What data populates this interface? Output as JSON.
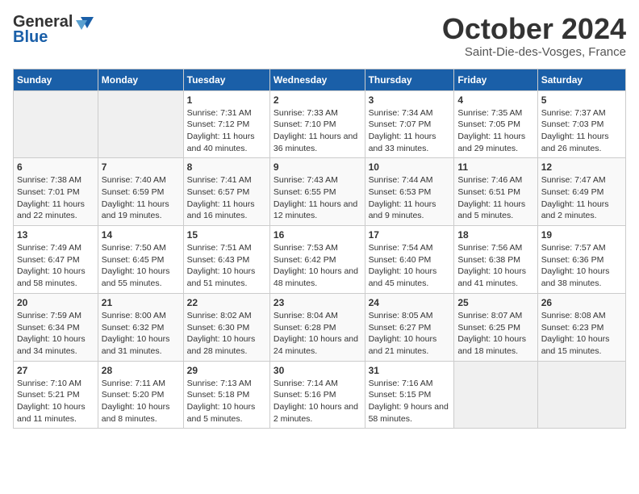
{
  "logo": {
    "general": "General",
    "blue": "Blue"
  },
  "title": "October 2024",
  "subtitle": "Saint-Die-des-Vosges, France",
  "days_header": [
    "Sunday",
    "Monday",
    "Tuesday",
    "Wednesday",
    "Thursday",
    "Friday",
    "Saturday"
  ],
  "weeks": [
    [
      {
        "day": "",
        "info": ""
      },
      {
        "day": "",
        "info": ""
      },
      {
        "day": "1",
        "info": "Sunrise: 7:31 AM\nSunset: 7:12 PM\nDaylight: 11 hours and 40 minutes."
      },
      {
        "day": "2",
        "info": "Sunrise: 7:33 AM\nSunset: 7:10 PM\nDaylight: 11 hours and 36 minutes."
      },
      {
        "day": "3",
        "info": "Sunrise: 7:34 AM\nSunset: 7:07 PM\nDaylight: 11 hours and 33 minutes."
      },
      {
        "day": "4",
        "info": "Sunrise: 7:35 AM\nSunset: 7:05 PM\nDaylight: 11 hours and 29 minutes."
      },
      {
        "day": "5",
        "info": "Sunrise: 7:37 AM\nSunset: 7:03 PM\nDaylight: 11 hours and 26 minutes."
      }
    ],
    [
      {
        "day": "6",
        "info": "Sunrise: 7:38 AM\nSunset: 7:01 PM\nDaylight: 11 hours and 22 minutes."
      },
      {
        "day": "7",
        "info": "Sunrise: 7:40 AM\nSunset: 6:59 PM\nDaylight: 11 hours and 19 minutes."
      },
      {
        "day": "8",
        "info": "Sunrise: 7:41 AM\nSunset: 6:57 PM\nDaylight: 11 hours and 16 minutes."
      },
      {
        "day": "9",
        "info": "Sunrise: 7:43 AM\nSunset: 6:55 PM\nDaylight: 11 hours and 12 minutes."
      },
      {
        "day": "10",
        "info": "Sunrise: 7:44 AM\nSunset: 6:53 PM\nDaylight: 11 hours and 9 minutes."
      },
      {
        "day": "11",
        "info": "Sunrise: 7:46 AM\nSunset: 6:51 PM\nDaylight: 11 hours and 5 minutes."
      },
      {
        "day": "12",
        "info": "Sunrise: 7:47 AM\nSunset: 6:49 PM\nDaylight: 11 hours and 2 minutes."
      }
    ],
    [
      {
        "day": "13",
        "info": "Sunrise: 7:49 AM\nSunset: 6:47 PM\nDaylight: 10 hours and 58 minutes."
      },
      {
        "day": "14",
        "info": "Sunrise: 7:50 AM\nSunset: 6:45 PM\nDaylight: 10 hours and 55 minutes."
      },
      {
        "day": "15",
        "info": "Sunrise: 7:51 AM\nSunset: 6:43 PM\nDaylight: 10 hours and 51 minutes."
      },
      {
        "day": "16",
        "info": "Sunrise: 7:53 AM\nSunset: 6:42 PM\nDaylight: 10 hours and 48 minutes."
      },
      {
        "day": "17",
        "info": "Sunrise: 7:54 AM\nSunset: 6:40 PM\nDaylight: 10 hours and 45 minutes."
      },
      {
        "day": "18",
        "info": "Sunrise: 7:56 AM\nSunset: 6:38 PM\nDaylight: 10 hours and 41 minutes."
      },
      {
        "day": "19",
        "info": "Sunrise: 7:57 AM\nSunset: 6:36 PM\nDaylight: 10 hours and 38 minutes."
      }
    ],
    [
      {
        "day": "20",
        "info": "Sunrise: 7:59 AM\nSunset: 6:34 PM\nDaylight: 10 hours and 34 minutes."
      },
      {
        "day": "21",
        "info": "Sunrise: 8:00 AM\nSunset: 6:32 PM\nDaylight: 10 hours and 31 minutes."
      },
      {
        "day": "22",
        "info": "Sunrise: 8:02 AM\nSunset: 6:30 PM\nDaylight: 10 hours and 28 minutes."
      },
      {
        "day": "23",
        "info": "Sunrise: 8:04 AM\nSunset: 6:28 PM\nDaylight: 10 hours and 24 minutes."
      },
      {
        "day": "24",
        "info": "Sunrise: 8:05 AM\nSunset: 6:27 PM\nDaylight: 10 hours and 21 minutes."
      },
      {
        "day": "25",
        "info": "Sunrise: 8:07 AM\nSunset: 6:25 PM\nDaylight: 10 hours and 18 minutes."
      },
      {
        "day": "26",
        "info": "Sunrise: 8:08 AM\nSunset: 6:23 PM\nDaylight: 10 hours and 15 minutes."
      }
    ],
    [
      {
        "day": "27",
        "info": "Sunrise: 7:10 AM\nSunset: 5:21 PM\nDaylight: 10 hours and 11 minutes."
      },
      {
        "day": "28",
        "info": "Sunrise: 7:11 AM\nSunset: 5:20 PM\nDaylight: 10 hours and 8 minutes."
      },
      {
        "day": "29",
        "info": "Sunrise: 7:13 AM\nSunset: 5:18 PM\nDaylight: 10 hours and 5 minutes."
      },
      {
        "day": "30",
        "info": "Sunrise: 7:14 AM\nSunset: 5:16 PM\nDaylight: 10 hours and 2 minutes."
      },
      {
        "day": "31",
        "info": "Sunrise: 7:16 AM\nSunset: 5:15 PM\nDaylight: 9 hours and 58 minutes."
      },
      {
        "day": "",
        "info": ""
      },
      {
        "day": "",
        "info": ""
      }
    ]
  ]
}
